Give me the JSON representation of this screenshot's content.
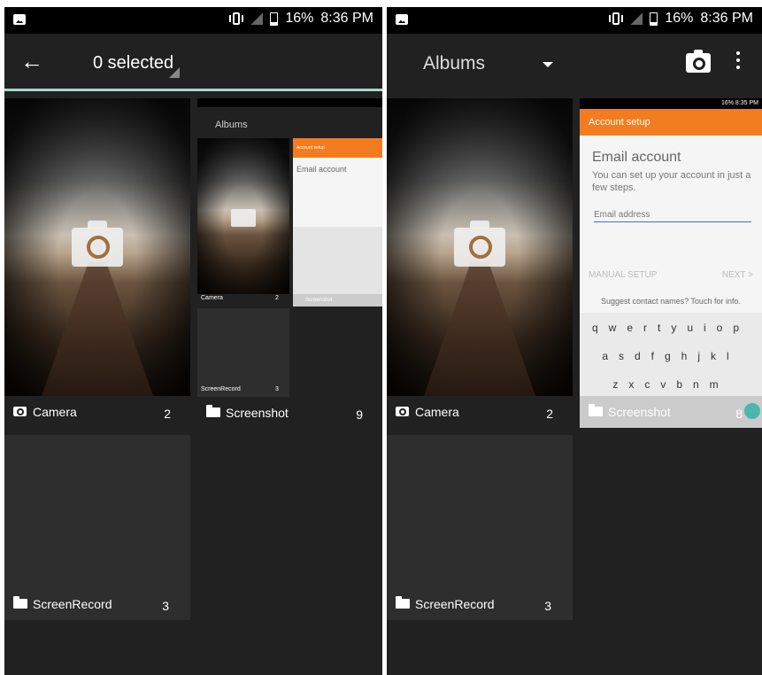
{
  "left": {
    "status": {
      "battery": "16%",
      "time": "8:36 PM"
    },
    "appbar": {
      "selection": "0 selected"
    },
    "albums": [
      {
        "name": "Camera",
        "count": "2"
      },
      {
        "name": "Screenshot",
        "count": "9"
      },
      {
        "name": "ScreenRecord",
        "count": "3"
      }
    ],
    "mini": {
      "status": "16% 8:36 PM",
      "title": "Albums",
      "camera_label": "Camera",
      "camera_count": "2",
      "record_label": "ScreenRecord",
      "record_count": "3",
      "ss_header": "Account setup",
      "ss_title": "Email account",
      "ss_label": "Screenshot"
    }
  },
  "right": {
    "status": {
      "battery": "16%",
      "time": "8:36 PM"
    },
    "appbar": {
      "title": "Albums"
    },
    "albums": [
      {
        "name": "Camera",
        "count": "2"
      },
      {
        "name": "Screenshot",
        "count": "8"
      },
      {
        "name": "ScreenRecord",
        "count": "3"
      }
    ],
    "screenshot_preview": {
      "status": "16% 8:35 PM",
      "header": "Account setup",
      "title": "Email account",
      "subtitle": "You can set up your account in just a few steps.",
      "field": "Email address",
      "manual": "MANUAL SETUP",
      "next": "NEXT  >",
      "suggest": "Suggest contact names? Touch for info.",
      "row1": "qwertyuiop",
      "row2": "asdfghjkl",
      "row3": "zxcvbnm"
    }
  },
  "colors": {
    "accent": "#a7d8cc",
    "orange": "#f47c20",
    "check": "#4db6ac"
  }
}
